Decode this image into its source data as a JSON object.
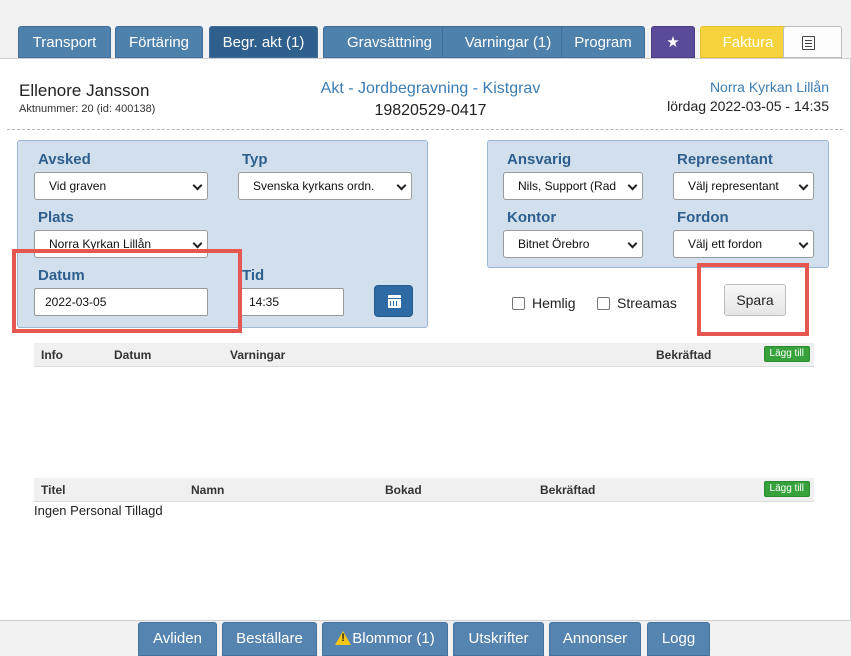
{
  "tabs": [
    {
      "label": "Transport"
    },
    {
      "label": "Förtäring"
    },
    {
      "label": "Begr. akt (1)"
    },
    {
      "label": "Gravsättning"
    },
    {
      "label": "Varningar (1)"
    },
    {
      "label": "Program"
    },
    {
      "label": "★"
    },
    {
      "label": "Faktura"
    },
    {
      "label": ""
    }
  ],
  "header": {
    "name": "Ellenore Jansson",
    "akt_number": "Aktnummer: 20 (id: 400138)",
    "type": "Akt - Jordbegravning - Kistgrav",
    "personnummer": "19820529-0417",
    "place": "Norra Kyrkan Lillån",
    "date": "lördag 2022-03-05 - 14:35"
  },
  "form_left": {
    "avsked_label": "Avsked",
    "avsked_value": "Vid graven",
    "typ_label": "Typ",
    "typ_value": "Svenska kyrkans ordn.",
    "plats_label": "Plats",
    "plats_value": "Norra Kyrkan Lillån",
    "datum_label": "Datum",
    "datum_value": "2022-03-05",
    "tid_label": "Tid",
    "tid_value": "14:35"
  },
  "form_right": {
    "ansvarig_label": "Ansvarig",
    "ansvarig_value": "Nils, Support (Rad",
    "representant_label": "Representant",
    "representant_value": "Välj representant",
    "kontor_label": "Kontor",
    "kontor_value": "Bitnet Örebro",
    "fordon_label": "Fordon",
    "fordon_value": "Välj ett fordon"
  },
  "options": {
    "hemlig_label": "Hemlig",
    "streamas_label": "Streamas",
    "save_label": "Spara"
  },
  "warnings_table": {
    "columns": [
      "Info",
      "Datum",
      "Varningar",
      "Bekräftad"
    ],
    "add_label": "Lägg till"
  },
  "staff_table": {
    "columns": [
      "Titel",
      "Namn",
      "Bokad",
      "Bekräftad"
    ],
    "add_label": "Lägg till",
    "empty": "Ingen Personal Tillagd"
  },
  "bottom_buttons": [
    {
      "label": "Avliden"
    },
    {
      "label": "Beställare"
    },
    {
      "label": "Blommor (1)"
    },
    {
      "label": "Utskrifter"
    },
    {
      "label": "Annonser"
    },
    {
      "label": "Logg"
    }
  ],
  "colors": {
    "tab_blue": "#4f81ad",
    "tab_active": "#2f5f8c",
    "star_tab": "#5b4a9a",
    "faktura_tab": "#f6d33c",
    "form_bg": "#d2e0ee",
    "label_blue": "#2e5f8e",
    "link_blue": "#3b7db4",
    "highlight_red": "#e5574f",
    "add_green": "#37a13c"
  },
  "icons": {
    "star_tab": "star-icon",
    "doc_tab": "document-icon",
    "calendar": "calendar-icon",
    "warning": "warning-icon"
  }
}
